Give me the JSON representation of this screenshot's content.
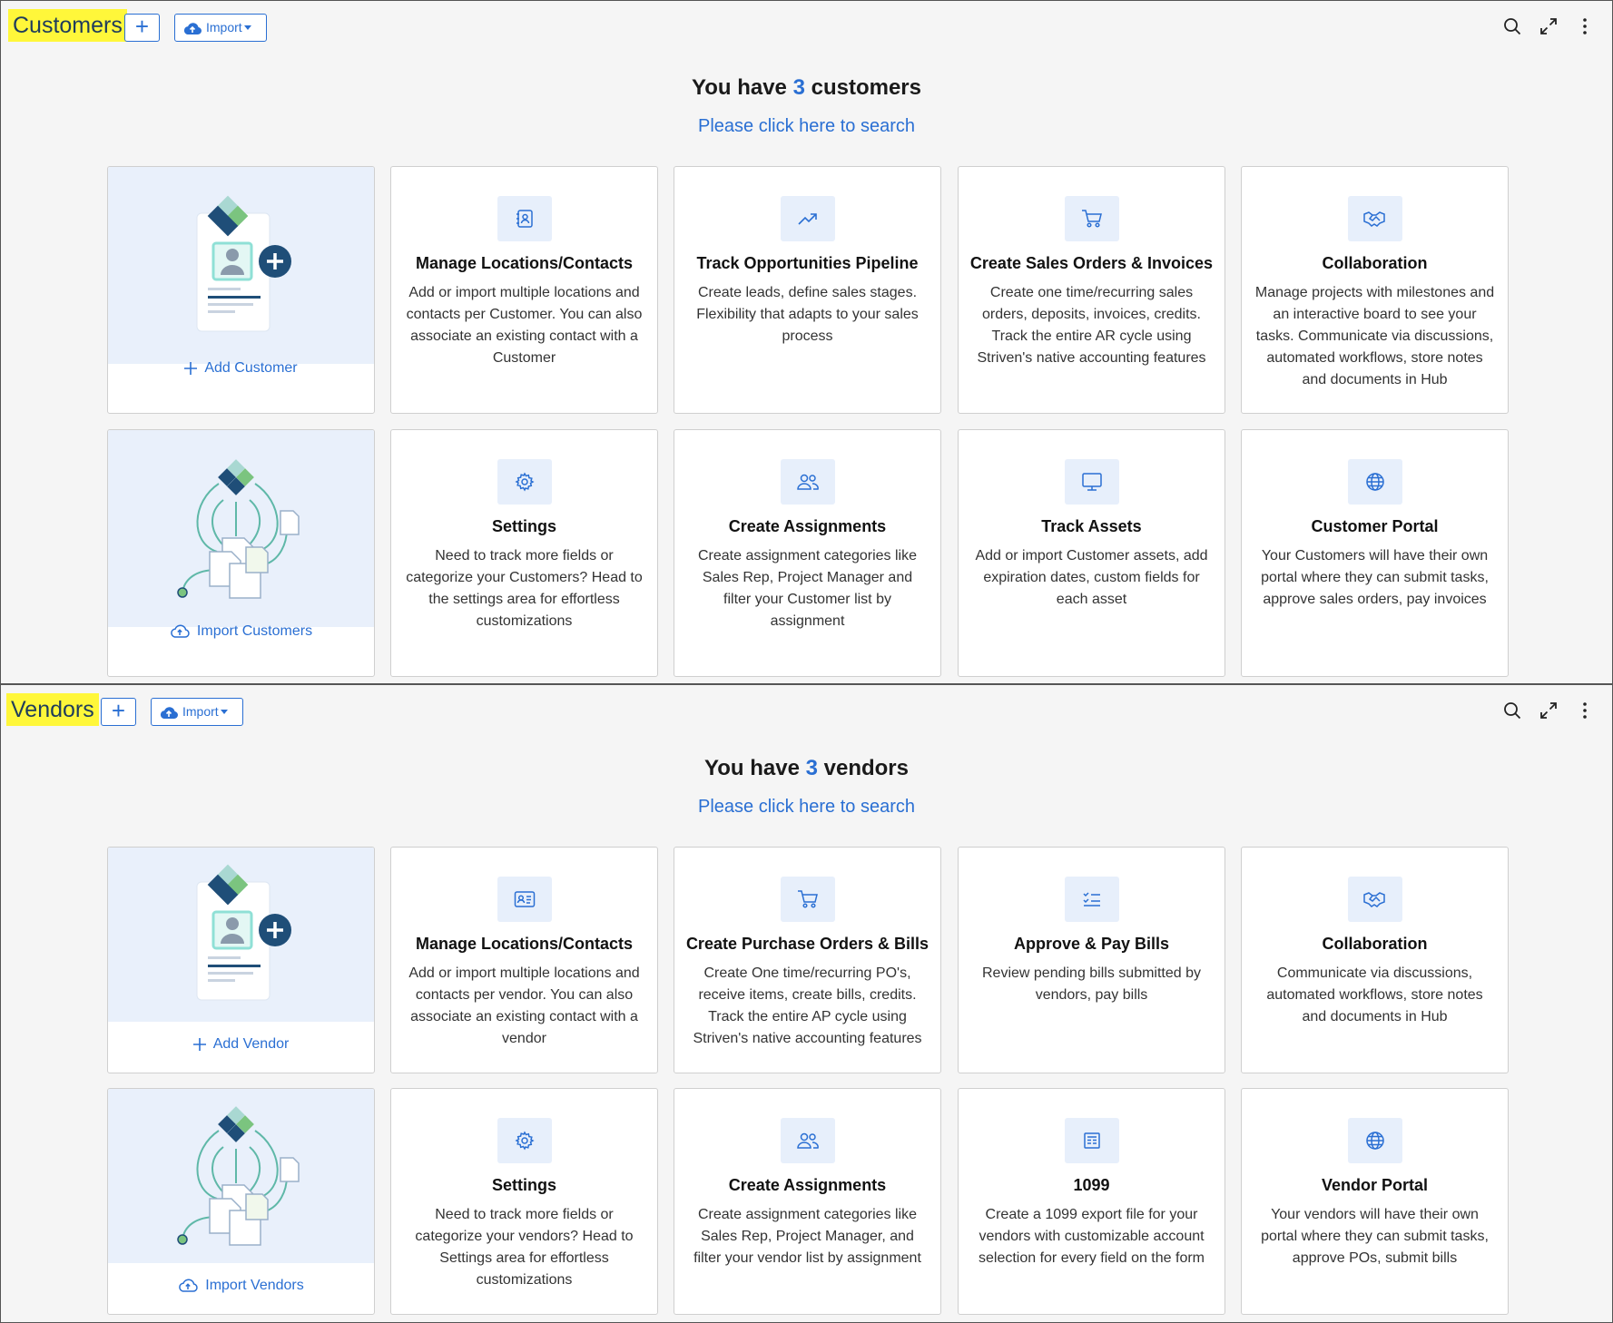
{
  "customers": {
    "title": "Customers",
    "add_label": "+",
    "import_label": "Import",
    "heading_pre": "You have",
    "count": "3",
    "heading_post": "customers",
    "search_link": "Please click here to search",
    "add_action": "Add Customer",
    "import_action": "Import Customers",
    "cards": [
      {
        "icon": "contact-card-icon",
        "title": "Manage Locations/Contacts",
        "desc": "Add or import multiple locations and contacts per Customer. You can also associate an existing contact with a Customer"
      },
      {
        "icon": "trend-up-icon",
        "title": "Track Opportunities Pipeline",
        "desc": "Create leads, define sales stages. Flexibility that adapts to your sales process"
      },
      {
        "icon": "cart-icon",
        "title": "Create Sales Orders & Invoices",
        "desc": "Create one time/recurring sales orders, deposits, invoices, credits. Track the entire AR cycle using Striven's native accounting features"
      },
      {
        "icon": "handshake-icon",
        "title": "Collaboration",
        "desc": "Manage projects with milestones and an interactive board to see your tasks. Communicate via discussions, automated workflows, store notes and documents in Hub"
      },
      {
        "icon": "gear-icon",
        "title": "Settings",
        "desc": "Need to track more fields or categorize your Customers? Head to the settings area for effortless customizations"
      },
      {
        "icon": "users-icon",
        "title": "Create Assignments",
        "desc": "Create assignment categories like Sales Rep, Project Manager and filter your Customer list by assignment"
      },
      {
        "icon": "monitor-icon",
        "title": "Track Assets",
        "desc": "Add or import Customer assets, add expiration dates, custom fields for each asset"
      },
      {
        "icon": "globe-icon",
        "title": "Customer Portal",
        "desc": "Your Customers will have their own portal where they can submit tasks, approve sales orders, pay invoices"
      }
    ]
  },
  "vendors": {
    "title": "Vendors",
    "add_label": "+",
    "import_label": "Import",
    "heading_pre": "You have",
    "count": "3",
    "heading_post": "vendors",
    "search_link": "Please click here to search",
    "add_action": "Add Vendor",
    "import_action": "Import Vendors",
    "cards": [
      {
        "icon": "id-card-icon",
        "title": "Manage Locations/Contacts",
        "desc": "Add or import multiple locations and contacts per vendor. You can also associate an existing contact with a vendor"
      },
      {
        "icon": "cart-icon",
        "title": "Create Purchase Orders & Bills",
        "desc": "Create One time/recurring PO's, receive items, create bills, credits. Track the entire AP cycle using Striven's native accounting features"
      },
      {
        "icon": "checklist-icon",
        "title": "Approve & Pay Bills",
        "desc": "Review pending bills submitted by vendors, pay bills"
      },
      {
        "icon": "handshake-icon",
        "title": "Collaboration",
        "desc": "Communicate via discussions, automated workflows, store notes and documents in Hub"
      },
      {
        "icon": "gear-icon",
        "title": "Settings",
        "desc": "Need to track more fields or categorize your vendors? Head to Settings area for effortless customizations"
      },
      {
        "icon": "users-icon",
        "title": "Create Assignments",
        "desc": "Create assignment categories like Sales Rep, Project Manager, and filter your vendor list by assignment"
      },
      {
        "icon": "form-icon",
        "title": "1099",
        "desc": "Create a 1099 export file for your vendors with customizable account selection for every field on the form"
      },
      {
        "icon": "globe-icon",
        "title": "Vendor Portal",
        "desc": "Your vendors will have their own portal where they can submit tasks, approve POs, submit bills"
      }
    ]
  },
  "toolbar_icons": [
    "search-icon",
    "expand-icon",
    "more-vertical-icon"
  ],
  "colors": {
    "accent": "#2a6fd3",
    "highlight": "#fff73a",
    "illustration_bg": "#e9f0fb",
    "icon_bg": "#e7effb"
  }
}
